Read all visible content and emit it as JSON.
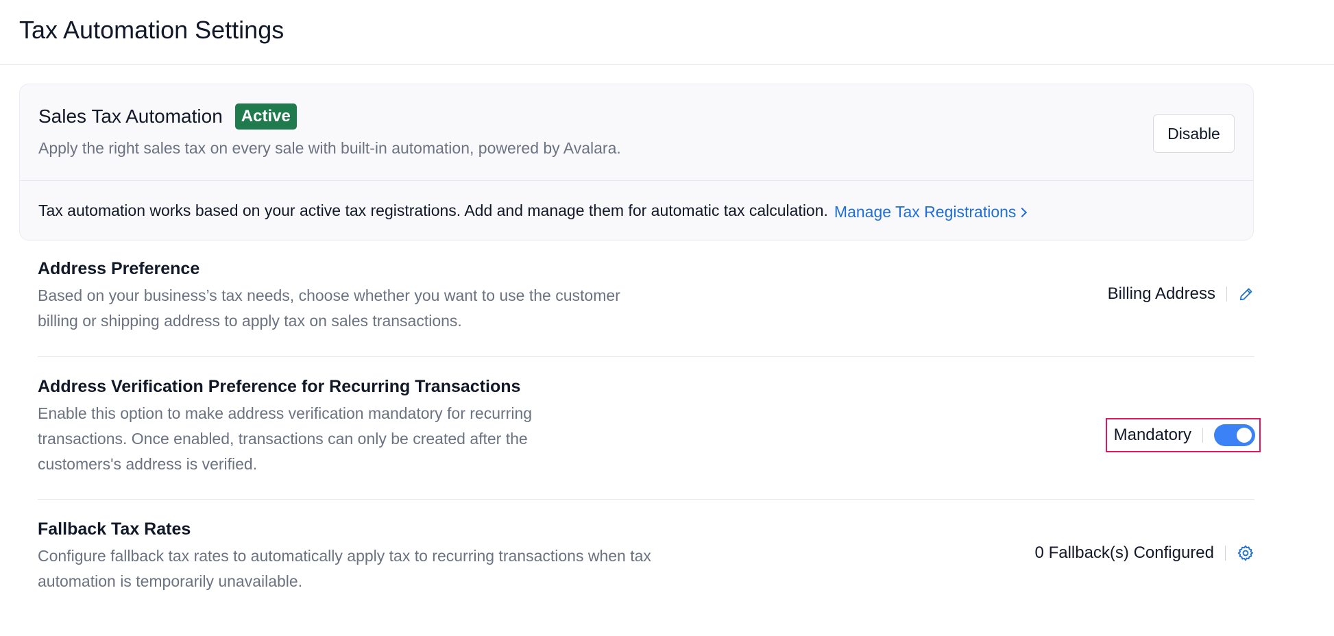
{
  "page": {
    "title": "Tax Automation Settings"
  },
  "automation_card": {
    "title": "Sales Tax Automation",
    "status": "Active",
    "description": "Apply the right sales tax on every sale with built-in automation, powered by Avalara.",
    "disable_label": "Disable",
    "info_text": "Tax automation works based on your active tax registrations. Add and manage them for automatic tax calculation.",
    "manage_link": "Manage Tax Registrations"
  },
  "address_preference": {
    "title": "Address Preference",
    "description": "Based on your business’s tax needs, choose whether you want to use the customer billing or shipping address to apply tax on sales transactions.",
    "value": "Billing Address",
    "icon": "pencil-icon"
  },
  "address_verification": {
    "title": "Address Verification Preference for Recurring Transactions",
    "description": "Enable this option to make address verification mandatory for recurring transactions. Once enabled, transactions can only be created after the customers's address is verified.",
    "value": "Mandatory",
    "toggle_on": true
  },
  "fallback_rates": {
    "title": "Fallback Tax Rates",
    "description": "Configure fallback tax rates to automatically apply tax to recurring transactions when tax automation is temporarily unavailable.",
    "value": "0 Fallback(s) Configured",
    "icon": "gear-icon"
  },
  "colors": {
    "accent": "#1f6fd6",
    "active_badge": "#1f7a4d",
    "toggle": "#3b82f6",
    "highlight": "#e3155d"
  }
}
